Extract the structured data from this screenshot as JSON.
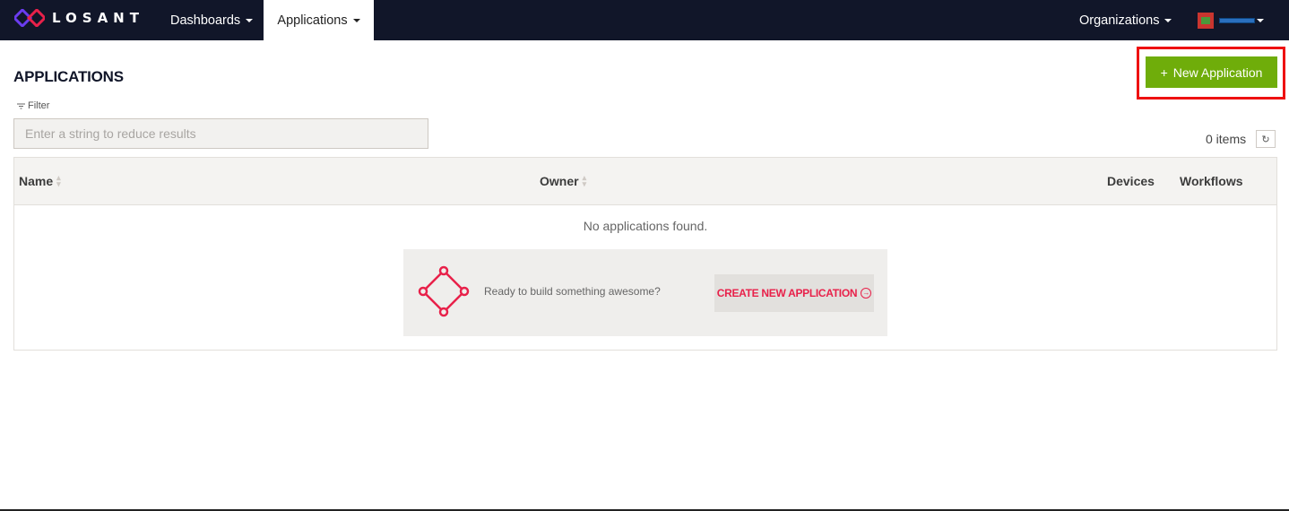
{
  "nav": {
    "brand": "LOSANT",
    "dashboards_label": "Dashboards",
    "applications_label": "Applications",
    "organizations_label": "Organizations"
  },
  "page": {
    "title": "APPLICATIONS",
    "new_button_plus": "+",
    "new_button_label": "New Application"
  },
  "filter": {
    "label": "Filter",
    "placeholder": "Enter a string to reduce results",
    "value": ""
  },
  "list": {
    "count": "0 items",
    "columns": [
      "Name",
      "Owner",
      "Devices",
      "Workflows"
    ],
    "empty_message": "No applications found."
  },
  "cta": {
    "text": "Ready to build something awesome?",
    "button_label": "CREATE NEW APPLICATION"
  },
  "colors": {
    "nav_bg": "#111629",
    "primary_button": "#6fad0a",
    "highlight_outline": "#ee1111",
    "cta_accent": "#e8214a"
  }
}
